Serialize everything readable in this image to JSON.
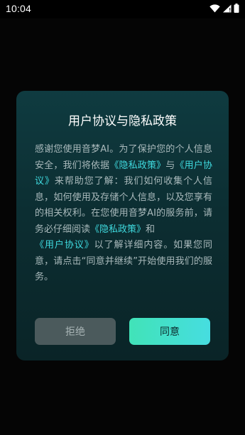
{
  "status_bar": {
    "time": "10:04",
    "icons": [
      "wifi-icon",
      "cellular-signal-icon",
      "battery-icon"
    ]
  },
  "dialog": {
    "title": "用户协议与隐私政策",
    "body": {
      "t1": "感谢您使用音梦AI。为了保护您的个人信息安全，我们将依据",
      "link_privacy_1": "《隐私政策》",
      "t2": "与",
      "link_user_1": "《用户协议》",
      "t3": "来帮助您了解：我们如何收集个人信息，如何使用及存储个人信息，以及您享有的相关权利。在您使用音梦AI的服务前，请务必仔细阅读",
      "link_privacy_2": "《隐私政策》",
      "t4": "和",
      "link_user_2": "《用户协议》",
      "t5": "以了解详细内容。如果您同意，请点击“同意并继续”开始使用我们的服务。"
    },
    "buttons": {
      "reject_label": "拒绝",
      "agree_label": "同意"
    }
  },
  "colors": {
    "link": "#3fd9de",
    "agree_gradient_start": "#41e3b8",
    "agree_gradient_end": "#46dde0",
    "reject_bg": "#4b5a5c",
    "dialog_bg": "#0f3b40"
  }
}
